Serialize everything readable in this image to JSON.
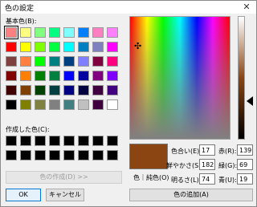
{
  "window": {
    "title": "色の設定",
    "close_glyph": "✕"
  },
  "basic_colors_label": "基本色(B):",
  "basic_colors": [
    "#ff8080",
    "#ffff80",
    "#80ff80",
    "#00ff80",
    "#80ffff",
    "#0080ff",
    "#ff80c0",
    "#ff80ff",
    "#ff0000",
    "#ffff00",
    "#80ff00",
    "#00ff40",
    "#00ffff",
    "#0080c0",
    "#8080c0",
    "#ff00ff",
    "#804040",
    "#ff8040",
    "#00ff00",
    "#008080",
    "#004080",
    "#8080ff",
    "#800040",
    "#ff0080",
    "#800000",
    "#ff8000",
    "#008000",
    "#008040",
    "#0000ff",
    "#0000a0",
    "#800080",
    "#8000ff",
    "#400000",
    "#804000",
    "#004000",
    "#004040",
    "#000080",
    "#000040",
    "#400040",
    "#400080",
    "#000000",
    "#808000",
    "#808040",
    "#808080",
    "#408080",
    "#c0c0c0",
    "#400040",
    "#ffffff"
  ],
  "custom_colors_label": "作成した色(C):",
  "custom_colors": [
    "#000000",
    "#000000",
    "#000000",
    "#000000",
    "#000000",
    "#000000",
    "#000000",
    "#000000",
    "#000000",
    "#000000",
    "#000000",
    "#000000",
    "#000000",
    "#000000",
    "#000000",
    "#000000"
  ],
  "define_button": "色の作成(D) >>",
  "ok_button": "OK",
  "cancel_button": "キャンセル",
  "preview_label": "色｜純色(O)",
  "preview_color": "#8b4513",
  "fields": {
    "hue": {
      "label": "色合い(E):",
      "value": "17"
    },
    "sat": {
      "label": "鮮やかさ(S):",
      "value": "182"
    },
    "lum": {
      "label": "明るさ(L):",
      "value": "74"
    },
    "red": {
      "label": "赤(R):",
      "value": "139"
    },
    "green": {
      "label": "緑(G):",
      "value": "69"
    },
    "blue": {
      "label": "青(U):",
      "value": "19"
    }
  },
  "add_button": "色の追加(A)",
  "crosshair_glyph": "✣"
}
